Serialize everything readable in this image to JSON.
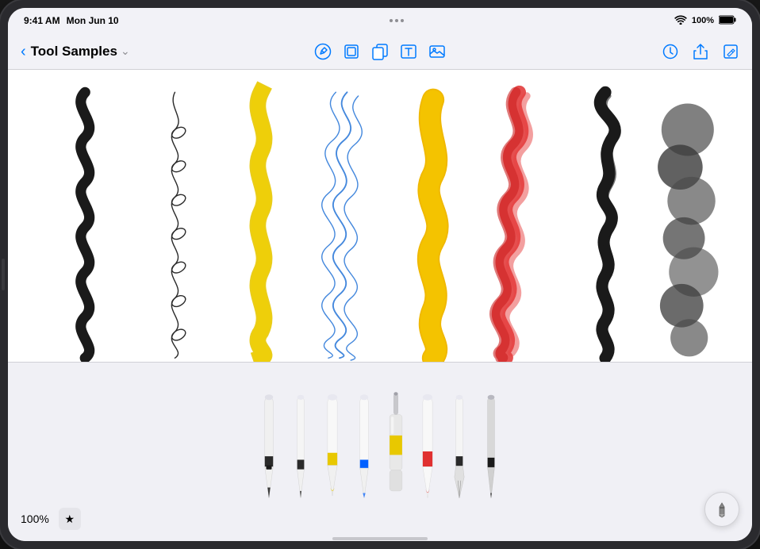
{
  "status_bar": {
    "time": "9:41 AM",
    "date": "Mon Jun 10",
    "wifi": "WiFi",
    "battery": "100%"
  },
  "toolbar": {
    "back_label": "‹",
    "title": "Tool Samples",
    "title_chevron": "⌄",
    "icons": {
      "pencil_circle": "✎",
      "layers": "⊡",
      "copy": "⎘",
      "text": "A",
      "image": "⊞",
      "history": "⏱",
      "share": "⬆",
      "edit": "✏"
    }
  },
  "zoom": "100%",
  "favorites_label": "★",
  "tools": [
    {
      "name": "fountain-pen",
      "color_band": "#1a1a1a",
      "tip": "round"
    },
    {
      "name": "fine-liner",
      "color_band": "#1a1a1a",
      "tip": "fine"
    },
    {
      "name": "brush-marker",
      "color_band": "#e8c800",
      "tip": "chisel"
    },
    {
      "name": "felt-tip",
      "color_band": "#0060ff",
      "tip": "round"
    },
    {
      "name": "paint-bottle",
      "color_band": "#e8c800",
      "tip": "bottle"
    },
    {
      "name": "crayon",
      "color_band": "#e83030",
      "tip": "round"
    },
    {
      "name": "technical-pen",
      "color_band": "#1a1a1a",
      "tip": "nib"
    },
    {
      "name": "graphite",
      "color_band": "#1a1a1a",
      "tip": "pencil"
    }
  ]
}
